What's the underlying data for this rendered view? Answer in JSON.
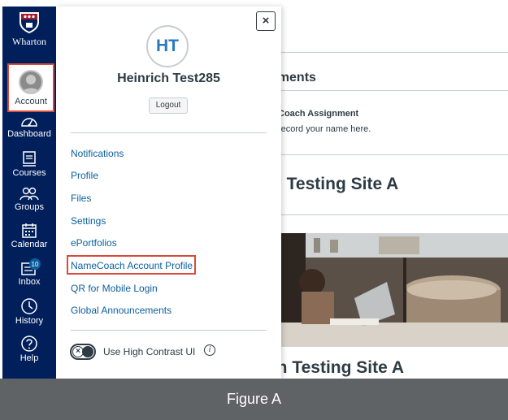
{
  "logo": {
    "wordmark": "Wharton"
  },
  "global_nav": {
    "items": [
      {
        "label": "Account",
        "icon": "user-avatar-icon"
      },
      {
        "label": "Dashboard",
        "icon": "dashboard-icon"
      },
      {
        "label": "Courses",
        "icon": "courses-icon"
      },
      {
        "label": "Groups",
        "icon": "groups-icon"
      },
      {
        "label": "Calendar",
        "icon": "calendar-icon"
      },
      {
        "label": "Inbox",
        "icon": "inbox-icon",
        "badge": "10"
      },
      {
        "label": "History",
        "icon": "history-icon"
      },
      {
        "label": "Help",
        "icon": "help-icon"
      }
    ]
  },
  "tray": {
    "close_label": "×",
    "avatar_initials": "HT",
    "user_name": "Heinrich Test285",
    "logout_label": "Logout",
    "links": [
      {
        "label": "Notifications"
      },
      {
        "label": "Profile"
      },
      {
        "label": "Files"
      },
      {
        "label": "Settings"
      },
      {
        "label": "ePortfolios"
      },
      {
        "label": "NameCoach Account Profile"
      },
      {
        "label": "QR for Mobile Login"
      },
      {
        "label": "Global Announcements"
      }
    ],
    "high_contrast_label": "Use High Contrast UI",
    "toggle_knob": "×",
    "info_glyph": "i"
  },
  "content": {
    "announcements_heading": "cements",
    "assignment_title": "Coach Assignment",
    "assignment_desc": "record your name here.",
    "site_heading_1": "n Testing Site A",
    "site_heading_2": "ch Testing Site A"
  },
  "caption": "Figure A",
  "colors": {
    "nav_bg": "#011F5B",
    "link": "#0b5f9e",
    "highlight": "#d94a3b",
    "caption_bg": "#5f6366"
  }
}
